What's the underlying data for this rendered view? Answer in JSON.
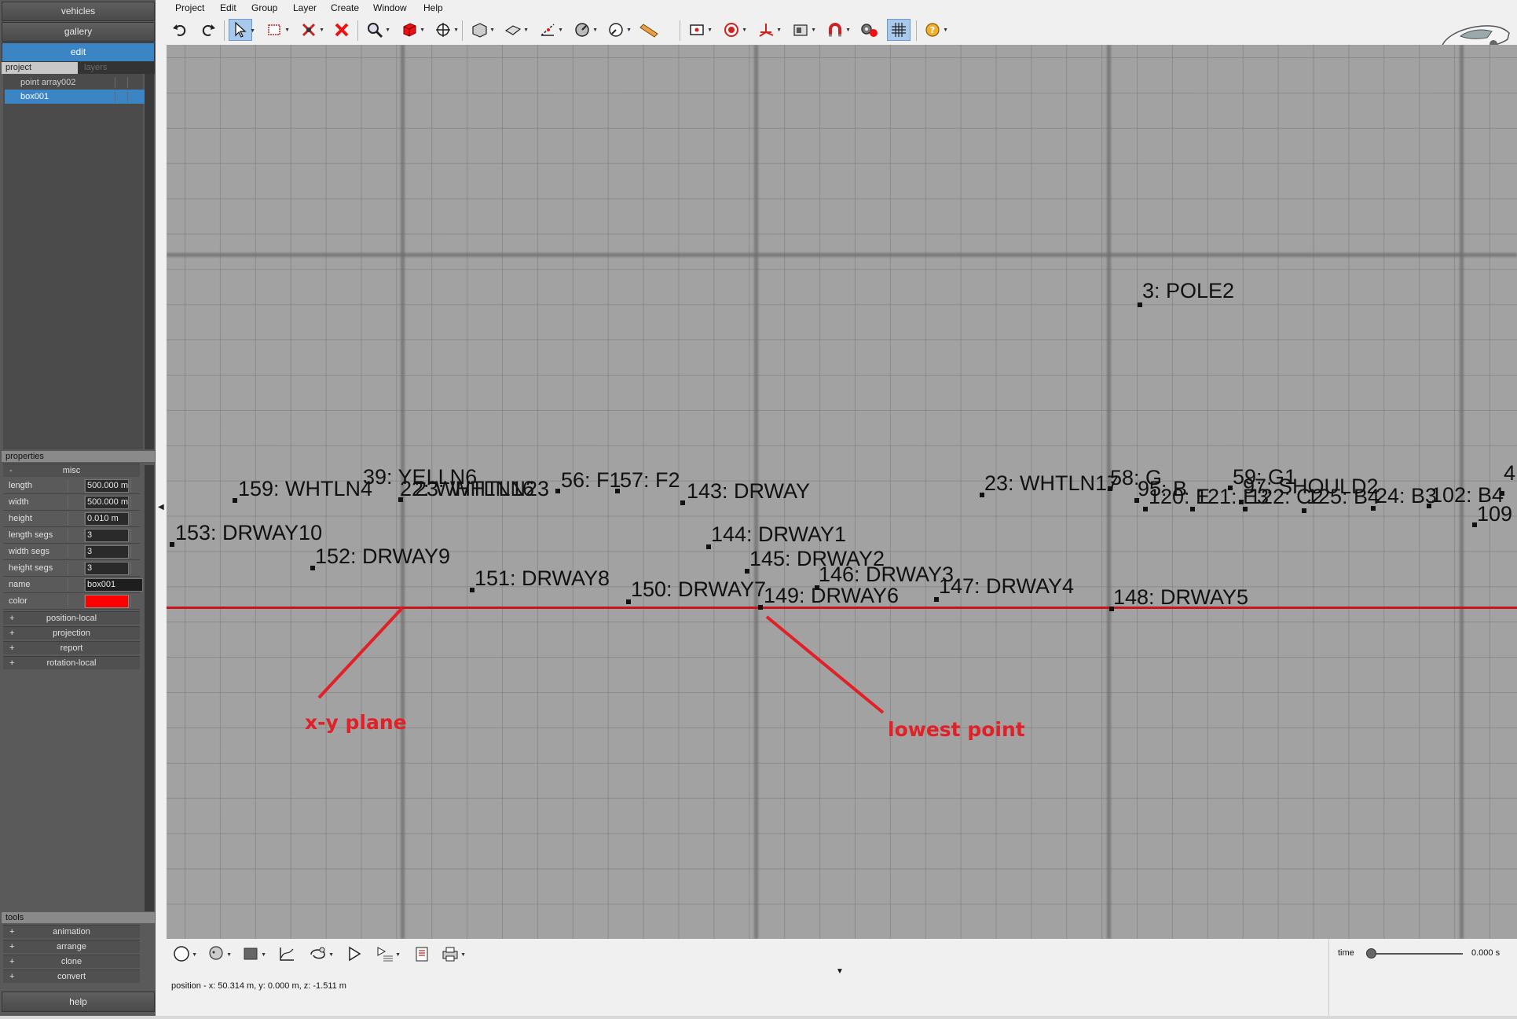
{
  "left_panel": {
    "nav": [
      "vehicles",
      "gallery",
      "edit"
    ],
    "tabs": {
      "project": "project",
      "layers": "layers"
    },
    "project_items": [
      "point array002",
      "box001"
    ],
    "properties_title": "properties",
    "misc_group": "misc",
    "misc_toggle": "-",
    "properties": [
      {
        "label": "length",
        "value": "500.000 m"
      },
      {
        "label": "width",
        "value": "500.000 m"
      },
      {
        "label": "height",
        "value": "0.010 m"
      },
      {
        "label": "length segs",
        "value": "3"
      },
      {
        "label": "width segs",
        "value": "3"
      },
      {
        "label": "height segs",
        "value": "3"
      },
      {
        "label": "name",
        "value": "box001"
      },
      {
        "label": "color",
        "value": "#ff0000"
      }
    ],
    "groups": [
      "position-local",
      "projection",
      "report",
      "rotation-local"
    ],
    "tools_title": "tools",
    "tools": [
      "animation",
      "arrange",
      "clone",
      "convert"
    ],
    "plus": "+",
    "help": "help"
  },
  "menu": [
    "Project",
    "Edit",
    "Group",
    "Layer",
    "Create",
    "Window",
    "Help"
  ],
  "toolbar_icons": [
    "undo-icon",
    "redo-icon",
    "select-arrow-icon",
    "select-box-icon",
    "pin-icon",
    "delete-x-icon",
    "zoom-icon",
    "cube-icon",
    "move-icon",
    "perspective-icon",
    "plane-icon",
    "measure-icon",
    "compass-icon",
    "gauge-icon",
    "ruler-icon",
    "frame-icon",
    "target-icon",
    "axes-icon",
    "snapshot-icon",
    "magnet-icon",
    "settings-icon",
    "grid-icon",
    "help-icon"
  ],
  "viewport": {
    "labels": [
      {
        "text": "3: POLE2"
      },
      {
        "text": "39: YELLN6"
      },
      {
        "text": "22: WHTLN16"
      },
      {
        "text": "56: F1"
      },
      {
        "text": "57: F2"
      },
      {
        "text": "159: WHTLN4"
      },
      {
        "text": "23: WHTLN23"
      },
      {
        "text": "143: DRWAY"
      },
      {
        "text": "23: WHTLN17"
      },
      {
        "text": "58: G"
      },
      {
        "text": "95: B"
      },
      {
        "text": "59: G1"
      },
      {
        "text": "120: E"
      },
      {
        "text": "121: E3"
      },
      {
        "text": "97: SHOULD2"
      },
      {
        "text": "122: C2"
      },
      {
        "text": "125: B4"
      },
      {
        "text": "24: B3"
      },
      {
        "text": "102: B4"
      },
      {
        "text": "4"
      },
      {
        "text": "109"
      },
      {
        "text": "153: DRWAY10"
      },
      {
        "text": "144: DRWAY1"
      },
      {
        "text": "152: DRWAY9"
      },
      {
        "text": "145: DRWAY2"
      },
      {
        "text": "151: DRWAY8"
      },
      {
        "text": "146: DRWAY3"
      },
      {
        "text": "150: DRWAY7"
      },
      {
        "text": "147: DRWAY4"
      },
      {
        "text": "149: DRWAY6"
      },
      {
        "text": "148: DRWAY5"
      }
    ],
    "annotations": [
      "x-y plane",
      "lowest point"
    ],
    "annotation_color": "#e12027",
    "plane_color": "#c8141c"
  },
  "bottom": {
    "time_label": "time",
    "time_value": "0.000 s",
    "position": "position - x: 50.314 m, y: 0.000 m, z: -1.511 m"
  }
}
